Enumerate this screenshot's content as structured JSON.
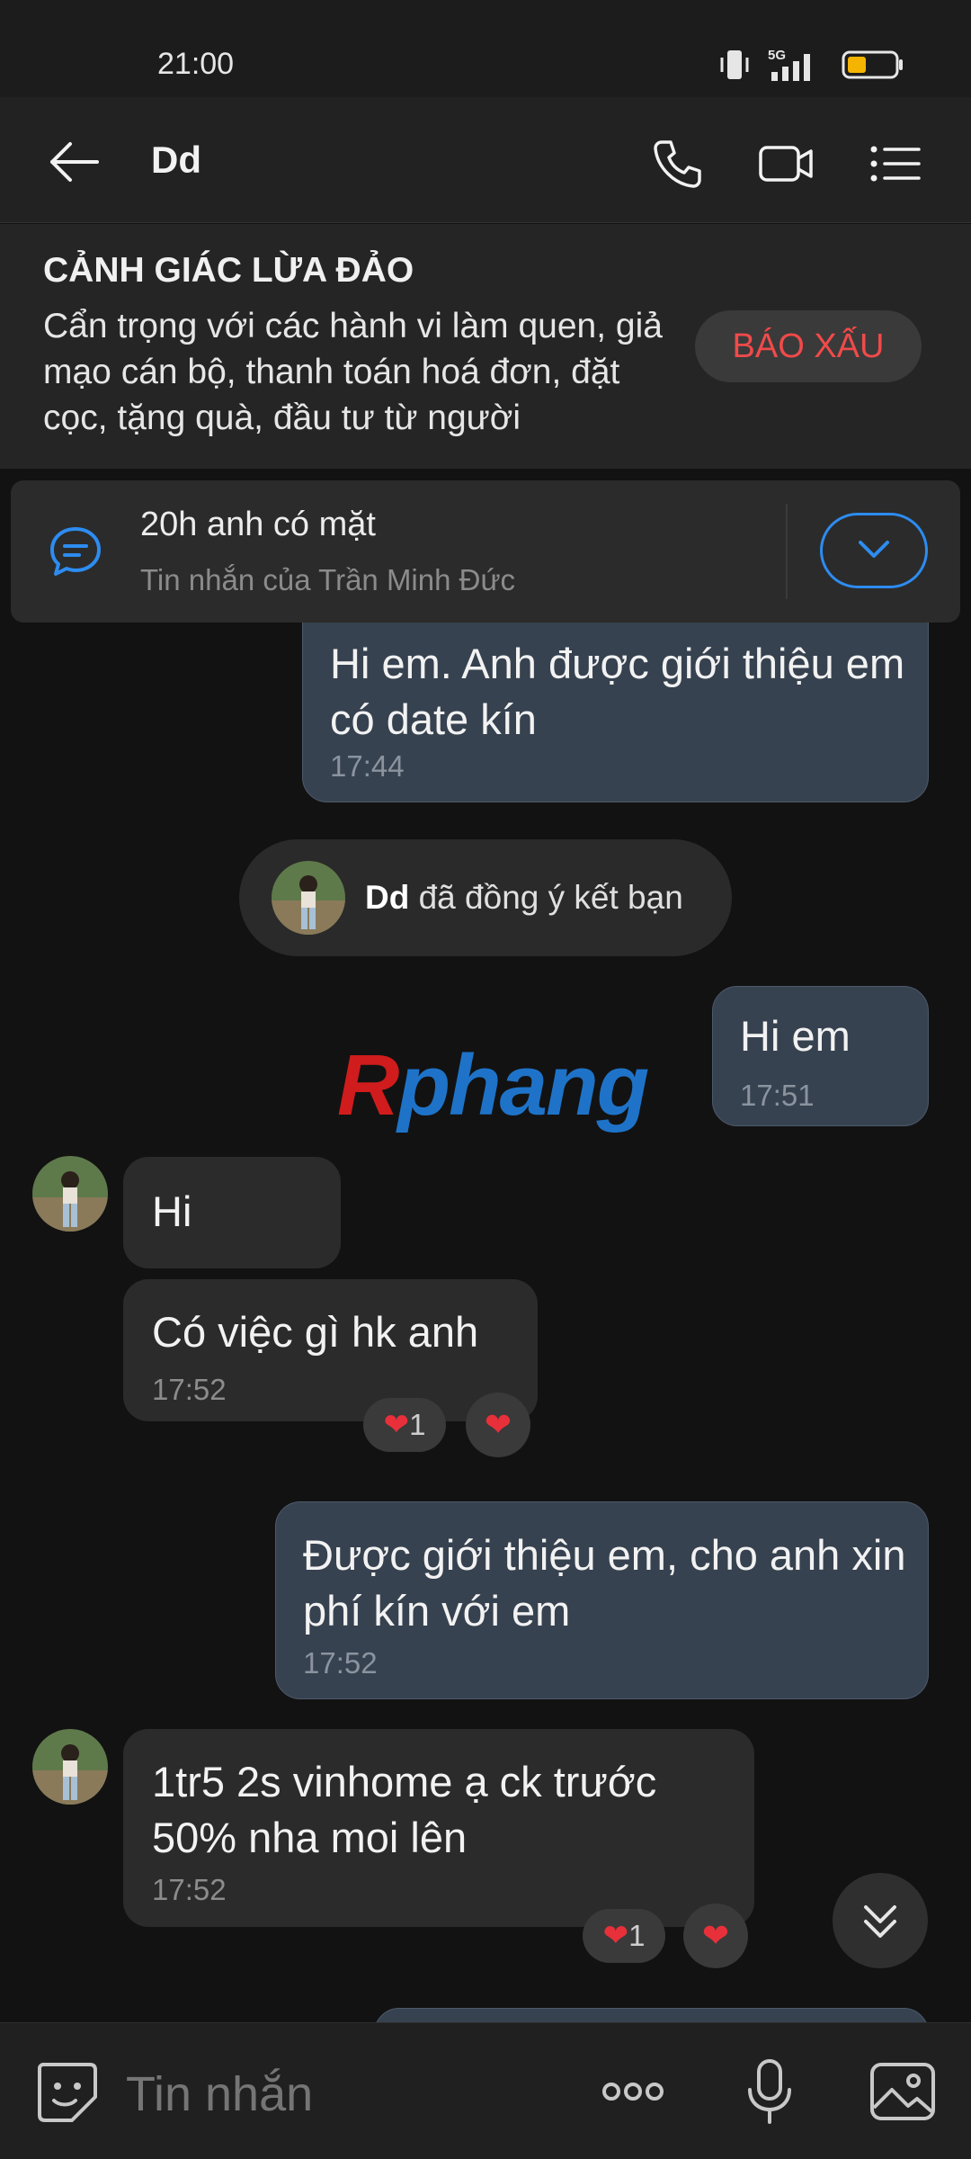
{
  "status_bar": {
    "time": "21:00",
    "network": "5G"
  },
  "header": {
    "title": "Dd"
  },
  "warning": {
    "title": "CẢNH GIÁC LỪA ĐẢO",
    "body": "Cẩn trọng với các hành vi làm quen, giả mạo cán bộ, thanh toán hoá đơn, đặt cọc, tặng quà, đầu tư từ người",
    "report_label": "BÁO XẤU"
  },
  "pinned": {
    "message": "20h anh có mặt",
    "subtitle": "Tin nhắn của Trần Minh Đức"
  },
  "chat": {
    "msg1": {
      "text": "Hi em. Anh được giới thiệu em có date kín",
      "time": "17:44"
    },
    "system": {
      "name": "Dd",
      "text": "đã đồng ý kết bạn"
    },
    "msg2": {
      "text": "Hi em",
      "time": "17:51"
    },
    "msg3": {
      "text": "Hi"
    },
    "msg4": {
      "text": "Có việc gì hk anh",
      "time": "17:52",
      "reaction_count": "1"
    },
    "msg5": {
      "text": "Được giới thiệu em, cho anh xin phí kín với em",
      "time": "17:52"
    },
    "msg6": {
      "text": "1tr5 2s vinhome ạ ck trước 50% nha moi lên",
      "time": "17:52",
      "reaction_count": "1"
    },
    "watermark": {
      "part1": "R",
      "part2": "phang"
    }
  },
  "input": {
    "placeholder": "Tin nhắn"
  },
  "colors": {
    "accent": "#2d8cf0",
    "report": "#f04a4a",
    "outgoing_bubble": "#374250",
    "incoming_bubble": "#2b2b2b"
  }
}
